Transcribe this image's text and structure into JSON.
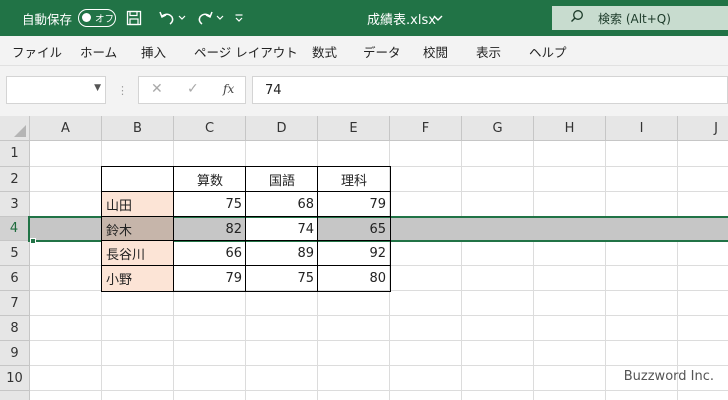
{
  "titlebar": {
    "autosave_label": "自動保存",
    "autosave_state": "オフ",
    "filename": "成績表.xlsx",
    "search_label": "検索 (Alt+Q)"
  },
  "ribbon": {
    "tabs": [
      "ファイル",
      "ホーム",
      "挿入",
      "ページ レイアウト",
      "数式",
      "データ",
      "校閲",
      "表示",
      "ヘルプ"
    ]
  },
  "formula_bar": {
    "name_box": "",
    "fx_label": "fx",
    "content": "74"
  },
  "grid": {
    "columns": [
      "A",
      "B",
      "C",
      "D",
      "E",
      "F",
      "G",
      "H",
      "I",
      "J"
    ],
    "rows": [
      "1",
      "2",
      "3",
      "4",
      "5",
      "6",
      "7",
      "8",
      "9",
      "10"
    ],
    "selected_row": "4"
  },
  "table": {
    "headers": [
      "算数",
      "国語",
      "理科"
    ],
    "rows": [
      {
        "name": "山田",
        "values": [
          "75",
          "68",
          "79"
        ]
      },
      {
        "name": "鈴木",
        "values": [
          "82",
          "74",
          "65"
        ]
      },
      {
        "name": "長谷川",
        "values": [
          "66",
          "89",
          "92"
        ]
      },
      {
        "name": "小野",
        "values": [
          "79",
          "75",
          "80"
        ]
      }
    ]
  },
  "watermark": "Buzzword Inc.",
  "colors": {
    "brand": "#217346",
    "name_fill": "#fce4d6",
    "row_selection": "#c6c6c6"
  }
}
